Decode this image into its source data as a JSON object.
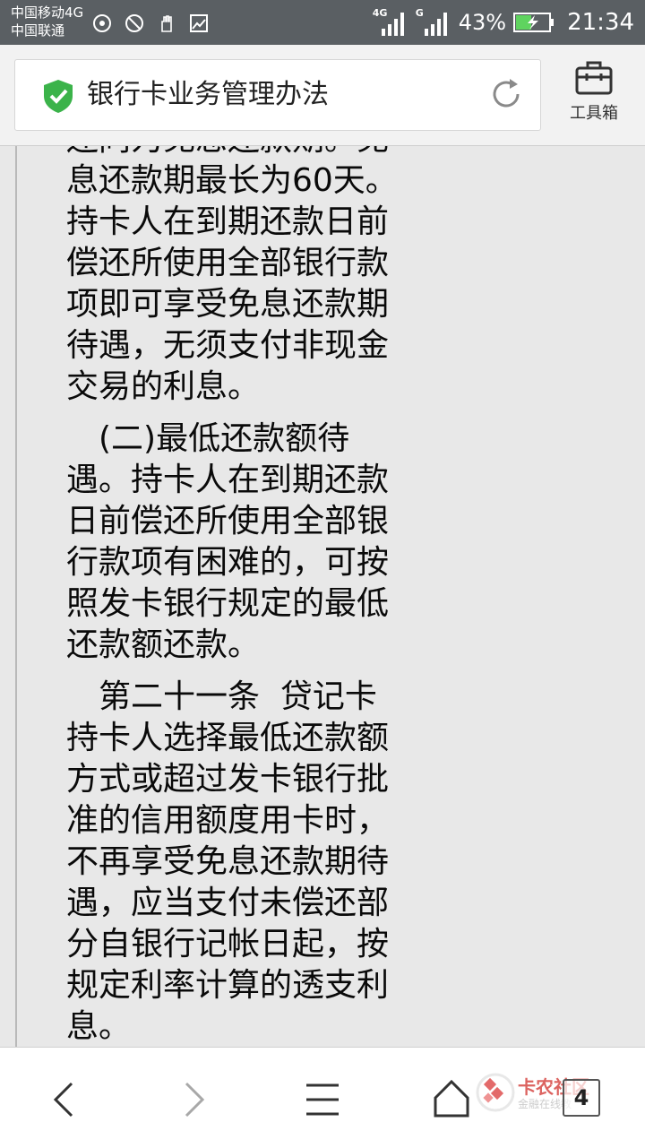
{
  "status_bar": {
    "carrier_1": "中国移动4G",
    "carrier_2": "中国联通",
    "net_1": "4G",
    "net_2": "G",
    "battery": "43%",
    "time": "21:34"
  },
  "header": {
    "page_title": "银行卡业务管理办法",
    "toolbox_label": "工具箱"
  },
  "content": {
    "partial_line": "还同为免息还款期。免",
    "paragraphs": [
      "息还款期最长为60天。持卡人在到期还款日前偿还所使用全部银行款项即可享受免息还款期待遇，无须支付非现金交易的利息。",
      "(二)最低还款额待遇。持卡人在到期还款日前偿还所使用全部银行款项有困难的，可按照发卡银行规定的最低还款额还款。",
      "第二十一条  贷记卡持卡人选择最低还款额方式或超过发卡银行批准的信用额度用卡时，不再享受免息还款期待遇，应当支付未偿还部分自银行记帐日起，按规定利率计算的透支利息。"
    ]
  },
  "bottom_nav": {
    "watermark_title": "卡农社区",
    "watermark_sub": "金融在线教",
    "tab_count": "4"
  },
  "colors": {
    "status_bar": "#5a5f63",
    "content_bg": "#e8e8e8",
    "shield_green": "#3bb34a",
    "watermark_red": "#d9534f"
  },
  "icons": [
    "signal-icon",
    "shield-check-icon",
    "reload-icon",
    "toolbox-icon",
    "back-icon",
    "forward-icon",
    "menu-icon",
    "home-icon"
  ]
}
